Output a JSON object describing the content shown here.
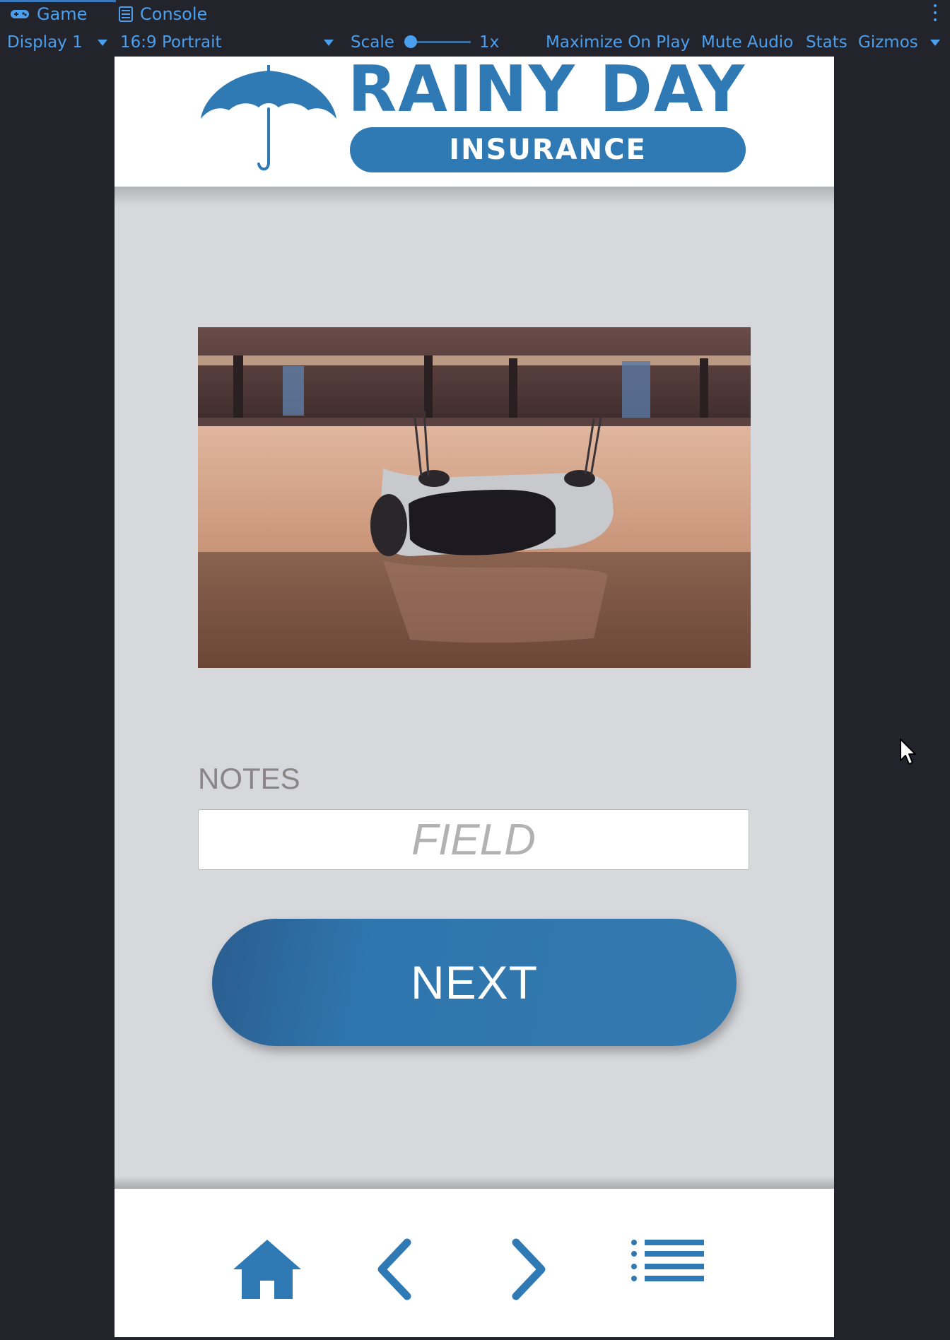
{
  "editor": {
    "tabs": [
      {
        "label": "Game",
        "icon": "gamepad-icon"
      },
      {
        "label": "Console",
        "icon": "console-icon"
      }
    ],
    "toolbar": {
      "display": "Display 1",
      "aspect": "16:9 Portrait",
      "scale_label": "Scale",
      "scale_value": "1x",
      "maximize_on_play": "Maximize On Play",
      "mute_audio": "Mute Audio",
      "stats": "Stats",
      "gizmos": "Gizmos"
    },
    "accent_color": "#4aa0ee",
    "background_color": "#23232b"
  },
  "app": {
    "brand": {
      "title": "RAINY DAY",
      "subtitle": "INSURANCE",
      "logo_icon": "umbrella-icon",
      "color": "#2f7ab4"
    },
    "photo": {
      "subject": "overturned car in floodwater"
    },
    "notes": {
      "label": "NOTES",
      "placeholder": "FIELD"
    },
    "next_button": {
      "label": "NEXT"
    },
    "nav": [
      {
        "name": "home",
        "icon": "home-icon"
      },
      {
        "name": "back",
        "icon": "chevron-left-icon"
      },
      {
        "name": "forward",
        "icon": "chevron-right-icon"
      },
      {
        "name": "menu",
        "icon": "list-icon"
      }
    ]
  }
}
